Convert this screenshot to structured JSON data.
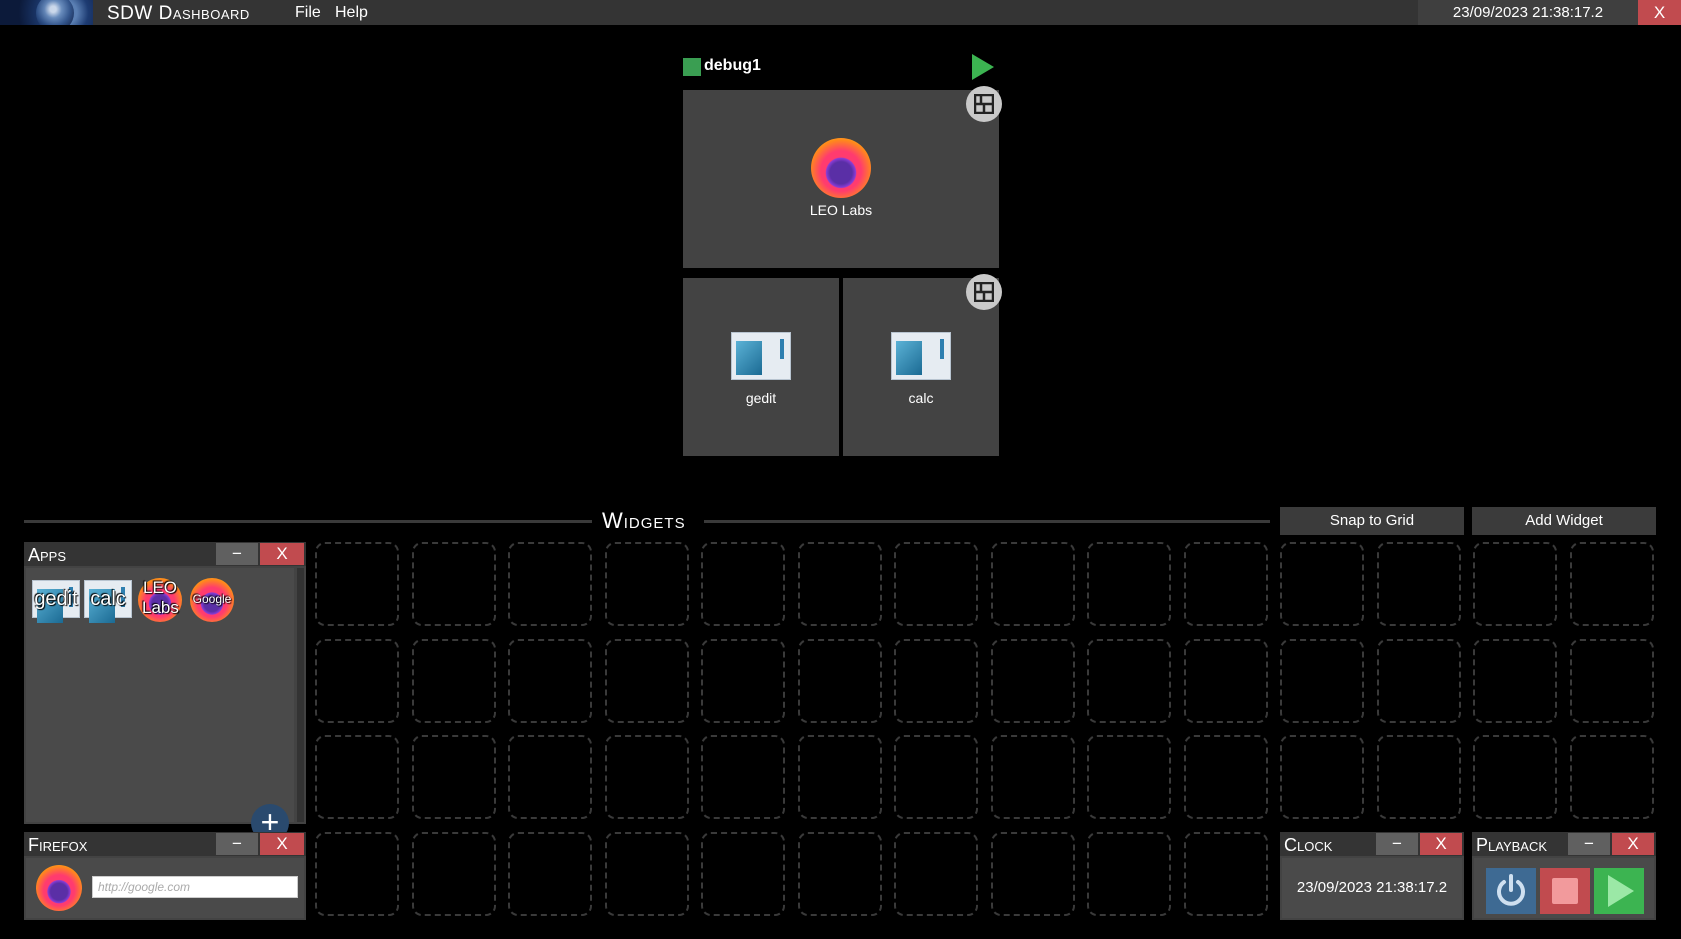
{
  "topbar": {
    "title": "SDW Dashboard",
    "menu": [
      "File",
      "Help"
    ],
    "clock": "23/09/2023 21:38:17.2",
    "close": "X"
  },
  "display": {
    "name": "debug1",
    "status_color": "#3a9e52",
    "tiles": [
      {
        "label": "LEO Labs",
        "icon": "firefox-icon"
      },
      {
        "label": "gedit",
        "icon": "window-icon"
      },
      {
        "label": "calc",
        "icon": "window-icon"
      }
    ]
  },
  "widgets_header": {
    "title": "Widgets",
    "snap_label": "Snap to Grid",
    "add_label": "Add Widget"
  },
  "apps_panel": {
    "title": "Apps",
    "minimize": "−",
    "close": "X",
    "apps": [
      {
        "label": "gedit",
        "icon": "window-icon"
      },
      {
        "label": "calc",
        "icon": "window-icon"
      },
      {
        "label": "LEO Labs",
        "icon": "firefox-icon"
      },
      {
        "label": "Google",
        "icon": "firefox-icon"
      }
    ],
    "add": "+"
  },
  "firefox_panel": {
    "title": "Firefox",
    "minimize": "−",
    "close": "X",
    "url_placeholder": "http://google.com"
  },
  "clock_panel": {
    "title": "Clock",
    "minimize": "−",
    "close": "X",
    "time": "23/09/2023 21:38:17.2"
  },
  "playback_panel": {
    "title": "Playback",
    "minimize": "−",
    "close": "X"
  },
  "colors": {
    "accent_green": "#3cb451",
    "close_red": "#c14b4f",
    "panel_gray": "#434343"
  }
}
